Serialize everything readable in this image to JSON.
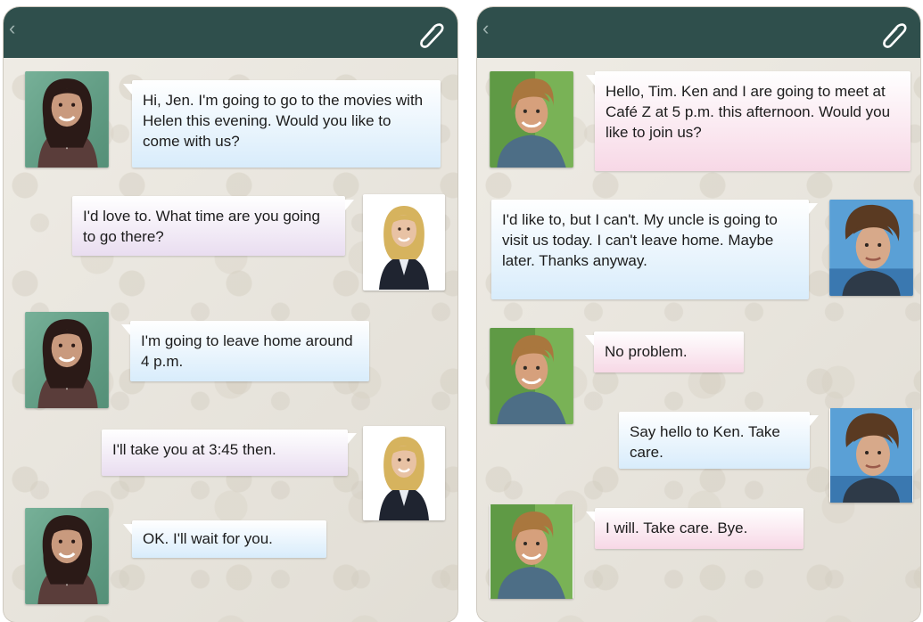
{
  "colors": {
    "header": "#2f4f4c",
    "bubble_blue": "#d8ecfb",
    "bubble_pink": "#f7d8e6",
    "bubble_lilac": "#e9ddf0"
  },
  "icons": {
    "back": "chevron-left-icon",
    "attach": "paperclip-icon"
  },
  "left_chat": {
    "back_glyph": "‹",
    "messages": [
      {
        "sender": "girl-dark-hair",
        "text": "Hi, Jen. I'm going to go to the movies with Helen this evening. Would you like to come with us?"
      },
      {
        "sender": "girl-blonde",
        "text": "I'd love to. What time are you going to go there?"
      },
      {
        "sender": "girl-dark-hair",
        "text": "I'm going to leave home around 4 p.m."
      },
      {
        "sender": "girl-blonde",
        "text": "I'll take you at 3:45 then."
      },
      {
        "sender": "girl-dark-hair",
        "text": "OK. I'll wait for you."
      }
    ]
  },
  "right_chat": {
    "back_glyph": "‹",
    "messages": [
      {
        "sender": "boy-smiling",
        "text": "Hello, Tim. Ken and I are going to meet at Café Z at 5 p.m. this afternoon. Would you like to join us?"
      },
      {
        "sender": "boy-brown-hair",
        "text": "I'd like to, but I can't. My uncle is going to visit us today. I can't leave home. Maybe later. Thanks anyway."
      },
      {
        "sender": "boy-smiling",
        "text": "No problem."
      },
      {
        "sender": "boy-brown-hair",
        "text": "Say hello to Ken. Take care."
      },
      {
        "sender": "boy-smiling",
        "text": "I will. Take care. Bye."
      }
    ]
  }
}
